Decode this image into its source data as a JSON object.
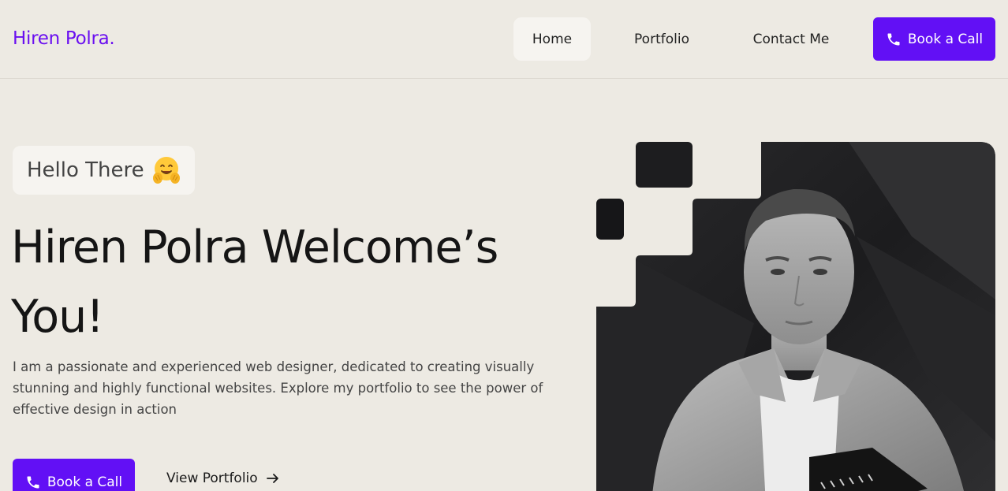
{
  "header": {
    "logo": "Hiren Polra.",
    "nav": [
      {
        "label": "Home"
      },
      {
        "label": "Portfolio"
      },
      {
        "label": "Contact Me"
      }
    ],
    "cta_label": "Book a Call",
    "cta_icon": "phone-icon"
  },
  "hero": {
    "greeting": "Hello There",
    "greeting_icon": "hugging-face-emoji",
    "title": "Hiren Polra Welcome’s You!",
    "description": "I am a passionate and experienced web designer, dedicated to creating visually stunning and highly functional websites. Explore my portfolio to see the power of effective design in action",
    "primary_button": "Book a Call",
    "secondary_button": "View Portfolio",
    "secondary_icon": "arrow-right-icon",
    "image_alt": "portrait photo"
  },
  "colors": {
    "accent": "#6210f5",
    "logo": "#6a0ff0",
    "background": "#edeae3",
    "nav_active_bg": "#f6f4f0"
  }
}
